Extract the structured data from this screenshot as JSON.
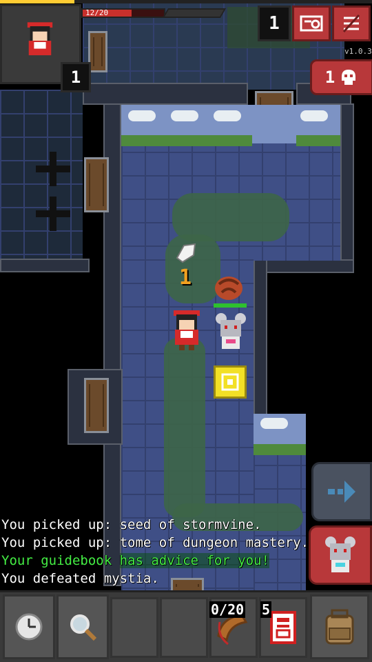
{
  "hud": {
    "hp_text": "12/20",
    "hp_fraction": 0.6,
    "exp_fraction": 0.2,
    "depth": "1",
    "version": "v1.0.3",
    "level": "1",
    "danger_count": "1"
  },
  "map": {
    "dropped_item_count": "1"
  },
  "log": [
    {
      "text": "You picked up: seed of stormvine.",
      "color": "#ffffff"
    },
    {
      "text": "You picked up: tome of dungeon mastery.",
      "color": "#ffffff"
    },
    {
      "text_a": "Your guidebook ",
      "text_b": "has advice for you!",
      "color": "#44ee44"
    },
    {
      "text": "You defeated mystia.",
      "color": "#ffffff"
    }
  ],
  "toolbar": {
    "quickslot_counts": "0/20",
    "quickslot_charges": "5"
  },
  "icons": {
    "wait": "clock-icon",
    "search": "magnifier-icon",
    "journal": "journal-icon",
    "menu": "menu-icon",
    "danger": "skull-icon",
    "resume": "arrow-right-icon",
    "attack": "mouse-enemy-icon",
    "inventory": "backpack-icon"
  },
  "colors": {
    "accent_red": "#b8383a",
    "hp_red": "#c8302c",
    "log_green": "#44ee44"
  }
}
